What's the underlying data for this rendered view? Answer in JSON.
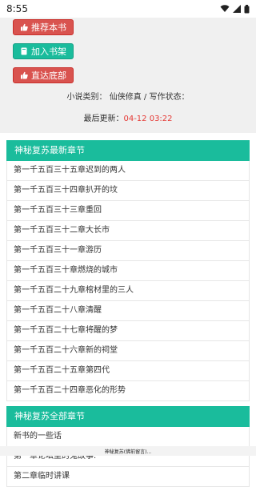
{
  "status": {
    "time": "8:55"
  },
  "actions": {
    "recommend": "推荐本书",
    "bookshelf": "加入书架",
    "bottom": "直达底部"
  },
  "meta": {
    "category_line": "小说类别： 仙侠修真 / 写作状态：",
    "updated_label": "最后更新：",
    "updated_time": "04-12 03:22"
  },
  "latest": {
    "title": "神秘复苏最新章节",
    "items": [
      "第一千五百三十五章迟到的两人",
      "第一千五百三十四章扒开的坟",
      "第一千五百三十三章重回",
      "第一千五百三十二章大长市",
      "第一千五百三十一章游历",
      "第一千五百三十章燃烧的城市",
      "第一千五百二十九章棺材里的三人",
      "第一千五百二十八章清醒",
      "第一千五百二十七章将醒的梦",
      "第一千五百二十六章新的祠堂",
      "第一千五百二十五章第四代",
      "第一千五百二十四章恶化的形势"
    ]
  },
  "all": {
    "title": "神秘复苏全部章节",
    "items": [
      "新书的一些话",
      "第一章论坛里的鬼故事.",
      "第二章临时讲课"
    ]
  },
  "bottom": {
    "text": "神秘复苏(佛前留言)..."
  }
}
